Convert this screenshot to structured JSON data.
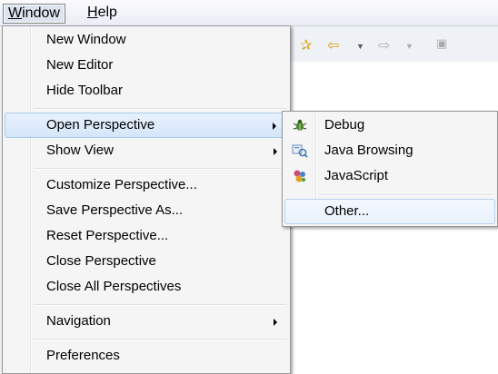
{
  "menubar": {
    "window": {
      "mnemonic": "W",
      "rest": "indow"
    },
    "help": {
      "mnemonic": "H",
      "rest": "elp"
    }
  },
  "toolbar": {
    "icons": [
      "pin-icon",
      "back-arrow-icon",
      "dropdown-icon",
      "forward-arrow-icon",
      "dropdown-icon",
      "restore-icon"
    ]
  },
  "window_menu": {
    "items": [
      {
        "label": "New Window"
      },
      {
        "label": "New Editor"
      },
      {
        "label": "Hide Toolbar"
      },
      {
        "label": "Open Perspective",
        "submenu": true
      },
      {
        "label": "Show View",
        "submenu": true
      },
      {
        "label": "Customize Perspective..."
      },
      {
        "label": "Save Perspective As..."
      },
      {
        "label": "Reset Perspective..."
      },
      {
        "label": "Close Perspective"
      },
      {
        "label": "Close All Perspectives"
      },
      {
        "label": "Navigation",
        "submenu": true
      },
      {
        "label": "Preferences"
      }
    ]
  },
  "open_perspective_submenu": {
    "items": [
      {
        "label": "Debug",
        "icon": "bug-icon"
      },
      {
        "label": "Java Browsing",
        "icon": "java-browsing-icon"
      },
      {
        "label": "JavaScript",
        "icon": "javascript-icon"
      },
      {
        "label": "Other..."
      }
    ]
  },
  "colors": {
    "highlight": "#d4e6fb",
    "menu_bg": "#f5f5f5",
    "menubar_bg": "#e9edf5"
  }
}
